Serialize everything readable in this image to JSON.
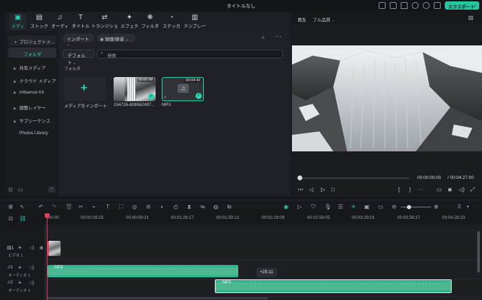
{
  "window": {
    "title": "タイトルなし",
    "export_label": "エクスポート"
  },
  "top_tabs": [
    {
      "label": "メディア",
      "icon": "media-icon",
      "active": true
    },
    {
      "label": "ストック",
      "icon": "stock-icon"
    },
    {
      "label": "オーディオ",
      "icon": "music-icon"
    },
    {
      "label": "タイトル",
      "icon": "title-icon"
    },
    {
      "label": "トランジション",
      "icon": "transition-icon"
    },
    {
      "label": "エフェクト",
      "icon": "effect-icon"
    },
    {
      "label": "フィルター",
      "icon": "filter-icon"
    },
    {
      "label": "ステッカー",
      "icon": "sticker-icon"
    },
    {
      "label": "テンプレート",
      "icon": "template-icon"
    }
  ],
  "sidebar": {
    "items": [
      {
        "label": "プロジェクトメ..."
      },
      {
        "label": "フォルダ",
        "selected": true
      },
      {
        "label": "共有メディア"
      },
      {
        "label": "クラウド メディア"
      },
      {
        "label": "Influence Kit"
      },
      {
        "label": "調整レイヤー"
      },
      {
        "label": "サブシーケンス"
      },
      {
        "label": "Photos Library"
      }
    ]
  },
  "media": {
    "import_label": "インポート",
    "record_label": "録画/録音",
    "sort_label": "デフォルト",
    "search_placeholder": "検索",
    "folder_label": "フォルダ",
    "import_tile_label": "メディアをインポート",
    "items": [
      {
        "name": "154726-808562497...",
        "duration": "00:00:08"
      },
      {
        "name": "MP3",
        "duration": "00:04:43"
      }
    ]
  },
  "preview": {
    "label": "再生",
    "quality": "フル品質",
    "current_time": "00:00:00:00",
    "total_time": "/ 00:04:27:00"
  },
  "timeline": {
    "ruler": [
      "00:00",
      "00:00:29:25",
      "00:00:59:21",
      "00:01:29:17",
      "00:01:59:13",
      "00:02:29:09",
      "00:02:59:05",
      "00:03:29:01",
      "00:03:58:27",
      "00:04:28:23"
    ],
    "tracks": [
      {
        "name": "ビデオ 1",
        "num": "1"
      },
      {
        "name": "オーディオ 1",
        "num": "1"
      },
      {
        "name": "オーディオ 2",
        "num": "2"
      }
    ],
    "clips": [
      {
        "label": "MP3"
      },
      {
        "label": "MP3"
      }
    ],
    "tooltip": "+25:11"
  },
  "colors": {
    "accent": "#2ad3ad",
    "clip": "#2fb28e",
    "playhead": "#e0405e"
  }
}
